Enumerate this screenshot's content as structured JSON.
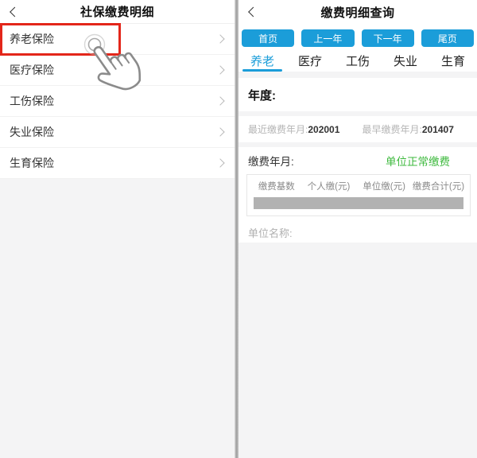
{
  "colors": {
    "accent_blue": "#1B9DD9",
    "highlight_red": "#E3261A",
    "status_green": "#3DB93D",
    "redacted_gray": "#B2B2B2"
  },
  "icons": {
    "back": "chevron-left",
    "row_arrow": "chevron-right",
    "tap": "hand-tap-cursor-with-ripple"
  },
  "left_screen": {
    "title": "社保缴费明细",
    "items": [
      {
        "label": "养老保险",
        "highlighted": true
      },
      {
        "label": "医疗保险",
        "highlighted": false
      },
      {
        "label": "工伤保险",
        "highlighted": false
      },
      {
        "label": "失业保险",
        "highlighted": false
      },
      {
        "label": "生育保险",
        "highlighted": false
      }
    ]
  },
  "right_screen": {
    "title": "缴费明细查询",
    "nav_buttons": {
      "first": "首页",
      "prev": "上一年",
      "next": "下一年",
      "last": "尾页"
    },
    "tabs": [
      {
        "label": "养老",
        "active": true
      },
      {
        "label": "医疗",
        "active": false
      },
      {
        "label": "工伤",
        "active": false
      },
      {
        "label": "失业",
        "active": false
      },
      {
        "label": "生育",
        "active": false
      }
    ],
    "year": {
      "label": "年度:"
    },
    "dates": {
      "recent_label": "最近缴费年月:",
      "recent_value": "202001",
      "earliest_label": "最早缴费年月:",
      "earliest_value": "201407"
    },
    "pay_month": {
      "label": "缴费年月:",
      "status": "单位正常缴费"
    },
    "table": {
      "headers": [
        "缴费基数",
        "个人缴(元)",
        "单位缴(元)",
        "缴费合计(元)"
      ]
    },
    "company": {
      "label": "单位名称:"
    }
  }
}
